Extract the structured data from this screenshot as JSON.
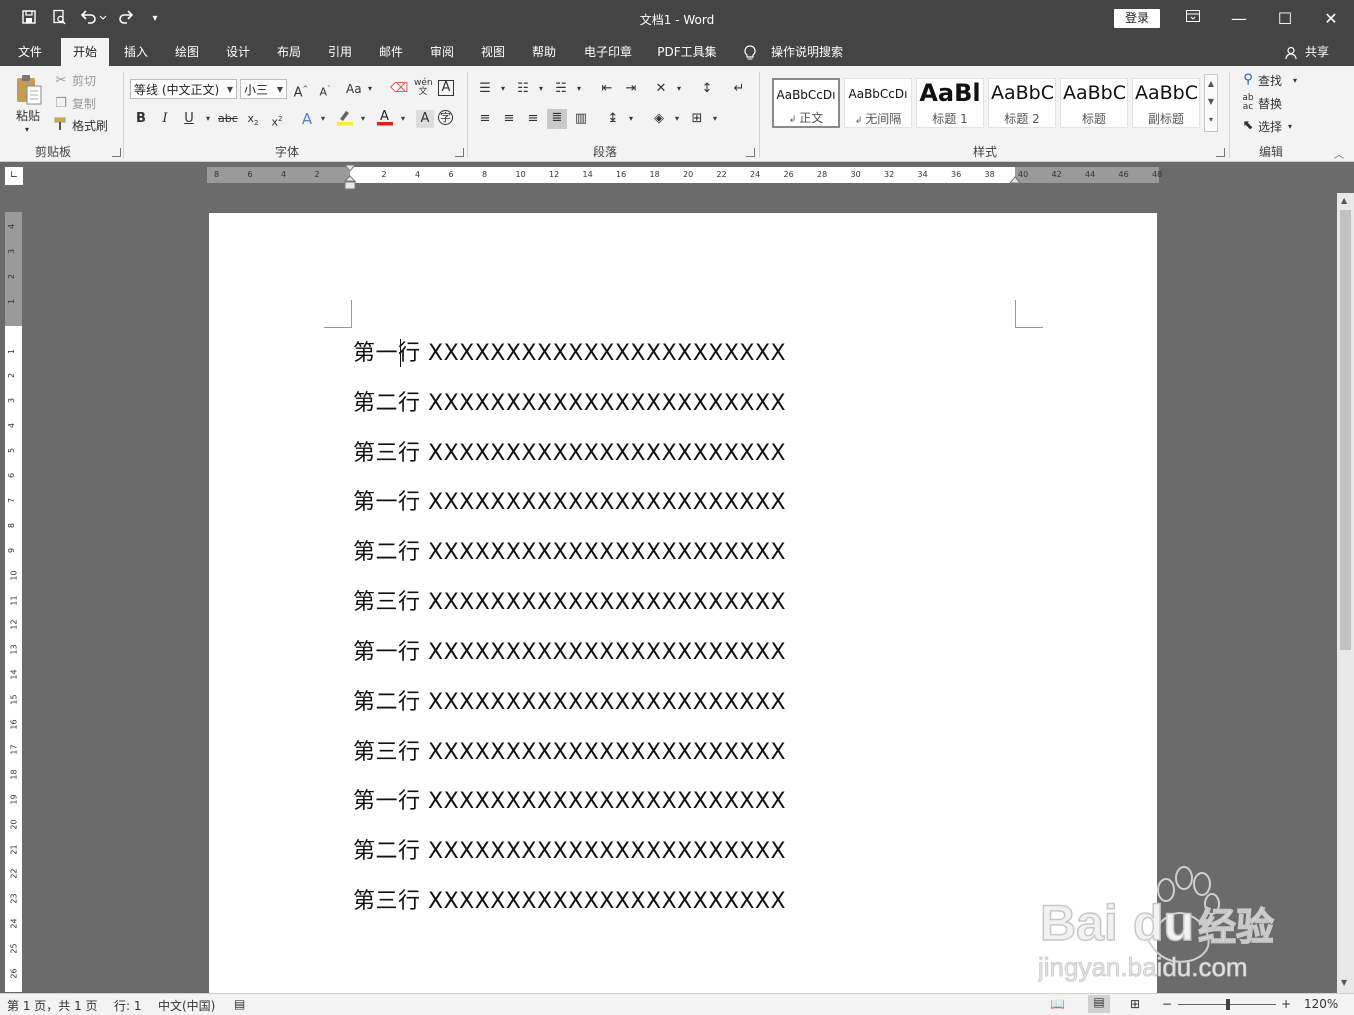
{
  "app": {
    "title": "文档1  -  Word",
    "login": "登录"
  },
  "tabs": [
    "文件",
    "开始",
    "插入",
    "绘图",
    "设计",
    "布局",
    "引用",
    "邮件",
    "审阅",
    "视图",
    "帮助",
    "电子印章",
    "PDF工具集"
  ],
  "active_tab": "开始",
  "tell_me": "操作说明搜索",
  "share": "共享",
  "ribbon": {
    "clipboard": {
      "group": "剪贴板",
      "paste": "粘贴",
      "cut": "剪切",
      "copy": "复制",
      "format_painter": "格式刷"
    },
    "font": {
      "group": "字体",
      "font_name": "等线 (中文正文)",
      "font_size": "小三",
      "aa_label": "Aa"
    },
    "paragraph": {
      "group": "段落"
    },
    "styles": {
      "group": "样式",
      "items": [
        {
          "sample": "AaBbCcDı",
          "name": "正文"
        },
        {
          "sample": "AaBbCcDı",
          "name": "无间隔"
        },
        {
          "sample": "AaBl",
          "name": "标题 1"
        },
        {
          "sample": "AaBbC",
          "name": "标题 2"
        },
        {
          "sample": "AaBbC",
          "name": "标题"
        },
        {
          "sample": "AaBbC",
          "name": "副标题"
        }
      ]
    },
    "editing": {
      "group": "编辑",
      "find": "查找",
      "replace": "替换",
      "select": "选择"
    }
  },
  "ruler": {
    "h_labels": [
      "8",
      "6",
      "4",
      "2",
      "",
      "2",
      "4",
      "6",
      "8",
      "10",
      "12",
      "14",
      "16",
      "18",
      "20",
      "22",
      "24",
      "26",
      "28",
      "30",
      "32",
      "34",
      "36",
      "38",
      "40",
      "42",
      "44",
      "46",
      "48"
    ],
    "v_labels": [
      "4",
      "3",
      "2",
      "1",
      "",
      "1",
      "2",
      "3",
      "4",
      "5",
      "6",
      "7",
      "8",
      "9",
      "10",
      "11",
      "12",
      "13",
      "14",
      "15",
      "16",
      "17",
      "18",
      "19",
      "20",
      "21",
      "22",
      "23",
      "24",
      "25",
      "26"
    ]
  },
  "document": {
    "lines": [
      "第一行 XXXXXXXXXXXXXXXXXXXXXXX",
      "第二行 XXXXXXXXXXXXXXXXXXXXXXX",
      "第三行 XXXXXXXXXXXXXXXXXXXXXXX",
      "第一行 XXXXXXXXXXXXXXXXXXXXXXX",
      "第二行 XXXXXXXXXXXXXXXXXXXXXXX",
      "第三行 XXXXXXXXXXXXXXXXXXXXXXX",
      "第一行 XXXXXXXXXXXXXXXXXXXXXXX",
      "第二行 XXXXXXXXXXXXXXXXXXXXXXX",
      "第三行 XXXXXXXXXXXXXXXXXXXXXXX",
      "第一行 XXXXXXXXXXXXXXXXXXXXXXX",
      "第二行 XXXXXXXXXXXXXXXXXXXXXXX",
      "第三行 XXXXXXXXXXXXXXXXXXXXXXX"
    ]
  },
  "status": {
    "page": "第 1 页，共 1 页",
    "line": "行: 1",
    "language": "中文(中国)",
    "zoom": "120%"
  },
  "watermark": {
    "brand": "Bai du 经验",
    "url": "jingyan.baidu.com"
  }
}
